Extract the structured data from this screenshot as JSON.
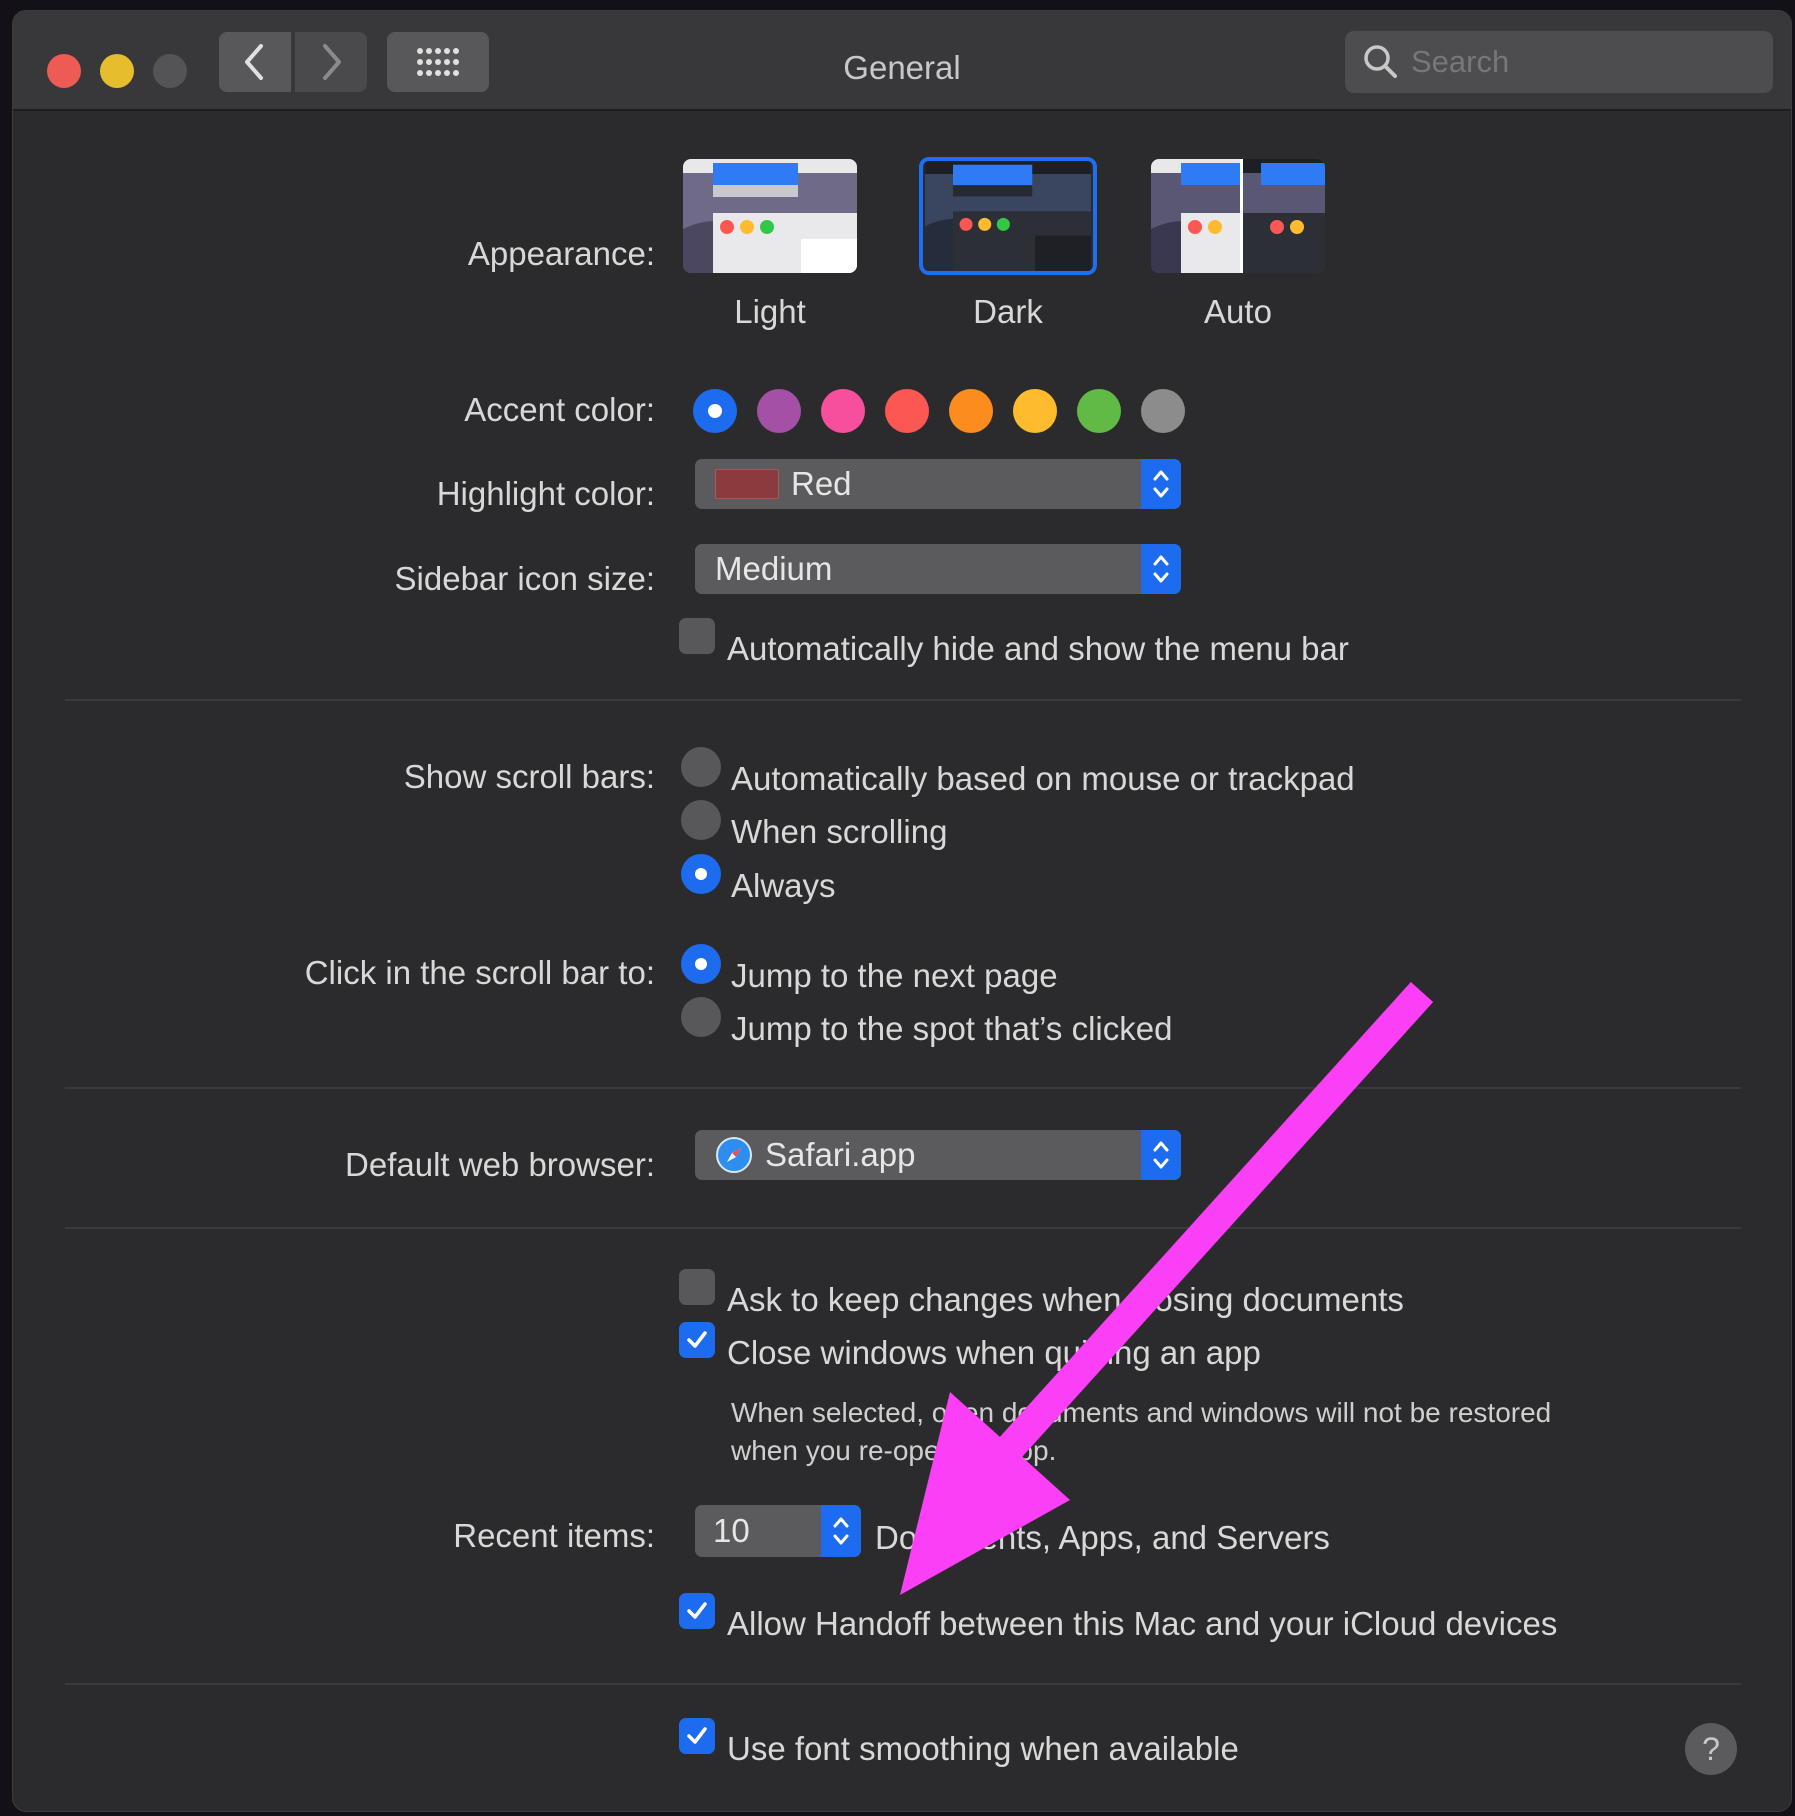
{
  "window": {
    "title": "General"
  },
  "search": {
    "placeholder": "Search"
  },
  "appearance": {
    "label": "Appearance:",
    "options": [
      {
        "name": "Light",
        "selected": false
      },
      {
        "name": "Dark",
        "selected": true
      },
      {
        "name": "Auto",
        "selected": false
      }
    ]
  },
  "accent": {
    "label": "Accent color:",
    "colors": [
      "#1d6cf0",
      "#a550a7",
      "#f74f9e",
      "#fc5753",
      "#fd8c1e",
      "#fdbb2d",
      "#62ba46",
      "#8c8c8c"
    ],
    "selected_index": 0
  },
  "highlight": {
    "label": "Highlight color:",
    "value": "Red",
    "swatch": "#8b3b3d"
  },
  "sidebar_icon": {
    "label": "Sidebar icon size:",
    "value": "Medium"
  },
  "menu_bar": {
    "label": "Automatically hide and show the menu bar",
    "checked": false
  },
  "scroll_bars": {
    "label": "Show scroll bars:",
    "options": [
      {
        "label": "Automatically based on mouse or trackpad",
        "checked": false
      },
      {
        "label": "When scrolling",
        "checked": false
      },
      {
        "label": "Always",
        "checked": true
      }
    ]
  },
  "click_scroll": {
    "label": "Click in the scroll bar to:",
    "options": [
      {
        "label": "Jump to the next page",
        "checked": true
      },
      {
        "label": "Jump to the spot that’s clicked",
        "checked": false
      }
    ]
  },
  "browser": {
    "label": "Default web browser:",
    "value": "Safari.app"
  },
  "ask_keep": {
    "label": "Ask to keep changes when closing documents",
    "checked": false
  },
  "close_windows": {
    "label": "Close windows when quitting an app",
    "checked": true,
    "note_line1": "When selected, open documents and windows will not be restored",
    "note_line2": "when you re-open an app."
  },
  "recent": {
    "label": "Recent items:",
    "value": "10",
    "suffix": "Documents, Apps, and Servers"
  },
  "handoff": {
    "label": "Allow Handoff between this Mac and your iCloud devices",
    "checked": true
  },
  "font_smoothing": {
    "label": "Use font smoothing when available",
    "checked": true
  },
  "help": {
    "label": "?"
  },
  "annotation": {
    "arrow_color": "#fb3ff7"
  }
}
